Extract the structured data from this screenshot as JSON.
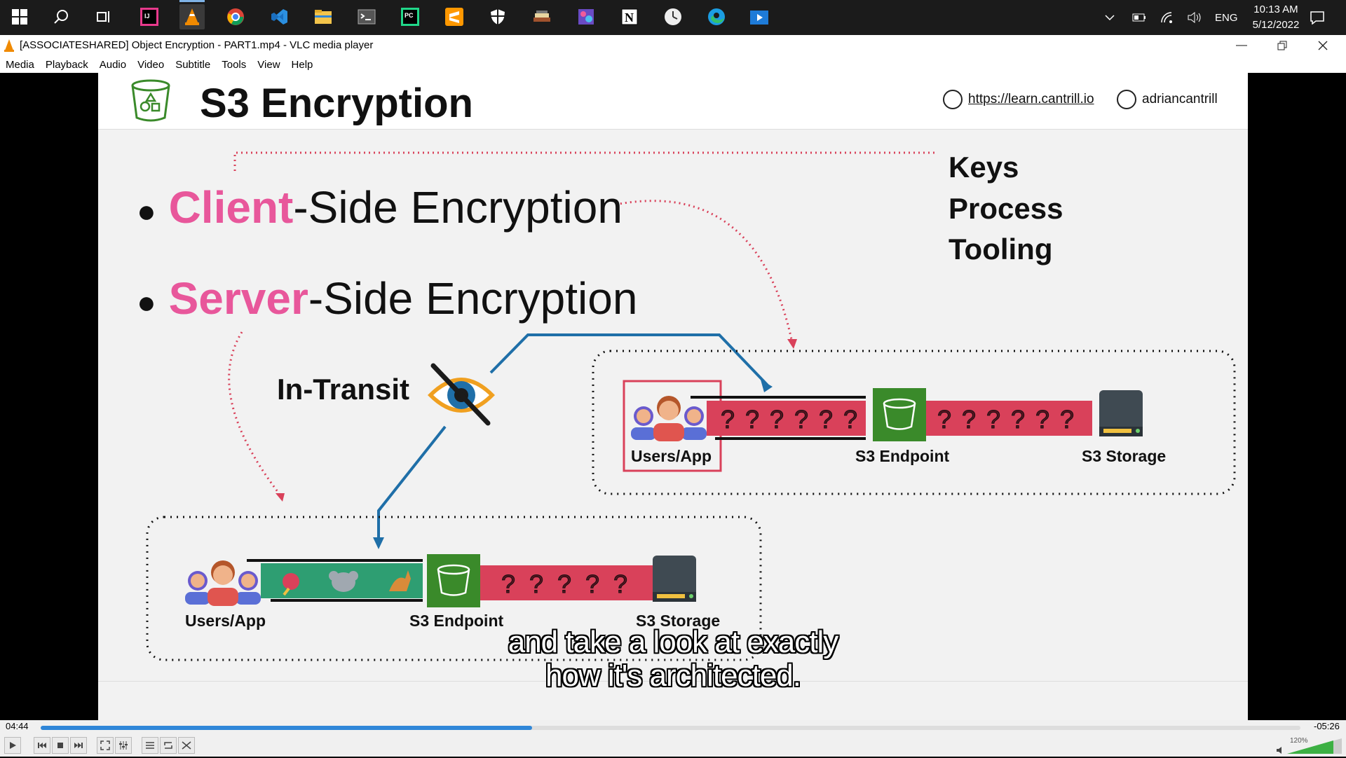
{
  "window": {
    "title": "[ASSOCIATESHARED] Object Encryption - PART1.mp4 - VLC media player"
  },
  "taskbar": {
    "apps": [
      {
        "name": "windows-start-icon"
      },
      {
        "name": "search-icon"
      },
      {
        "name": "task-view-icon"
      },
      {
        "name": "intellij-icon"
      },
      {
        "name": "vlc-icon"
      },
      {
        "name": "chrome-icon"
      },
      {
        "name": "vscode-icon"
      },
      {
        "name": "file-explorer-icon"
      },
      {
        "name": "terminal-icon"
      },
      {
        "name": "pycharm-icon"
      },
      {
        "name": "sublime-icon"
      },
      {
        "name": "security-shield-icon"
      },
      {
        "name": "books-icon"
      },
      {
        "name": "photos-icon"
      },
      {
        "name": "notion-icon"
      },
      {
        "name": "clock-app-icon"
      },
      {
        "name": "edge-icon"
      },
      {
        "name": "media-player-icon"
      }
    ],
    "language": "ENG",
    "time": "10:13 AM",
    "date": "5/12/2022"
  },
  "menu": [
    "Media",
    "Playback",
    "Audio",
    "Video",
    "Subtitle",
    "Tools",
    "View",
    "Help"
  ],
  "slide": {
    "title": "S3 Encryption",
    "link": "https://learn.cantrill.io",
    "twitter": "adriancantrill",
    "bullet1_highlight": "Client",
    "bullet1_rest": "-Side Encryption",
    "bullet2_highlight": "Server",
    "bullet2_rest": "-Side Encryption",
    "kpt": [
      "Keys",
      "Process",
      "Tooling"
    ],
    "in_transit": "In-Transit",
    "top_flow": {
      "users": "Users/App",
      "endpoint": "S3 Endpoint",
      "storage": "S3 Storage"
    },
    "bottom_flow": {
      "users": "Users/App",
      "endpoint": "S3 Endpoint",
      "storage": "S3 Storage"
    }
  },
  "subtitles": {
    "line1": "and take a look at exactly",
    "line2": "how it's architected."
  },
  "player": {
    "elapsed": "04:44",
    "remaining": "-05:26",
    "progress": 0.39,
    "volume": "120%",
    "colors": {
      "accent": "#2f86d8",
      "pink": "#e8579b",
      "red_bar": "#d9415a",
      "green": "#3a8a2a"
    }
  }
}
